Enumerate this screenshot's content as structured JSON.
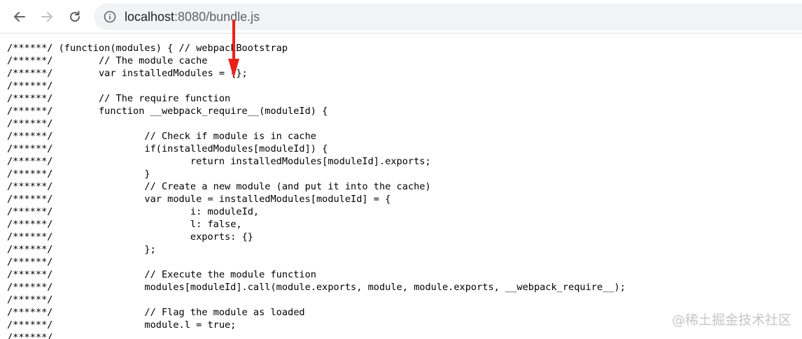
{
  "browser": {
    "url_host": "localhost",
    "url_rest": ":8080/bundle.js",
    "icons": {
      "back": "arrow-back-icon",
      "forward": "arrow-forward-icon",
      "reload": "reload-icon",
      "info": "info-icon"
    }
  },
  "code": {
    "lines": [
      "/******/ (function(modules) { // webpackBootstrap",
      "/******/ \t// The module cache",
      "/******/ \tvar installedModules = {};",
      "/******/",
      "/******/ \t// The require function",
      "/******/ \tfunction __webpack_require__(moduleId) {",
      "/******/",
      "/******/ \t\t// Check if module is in cache",
      "/******/ \t\tif(installedModules[moduleId]) {",
      "/******/ \t\t\treturn installedModules[moduleId].exports;",
      "/******/ \t\t}",
      "/******/ \t\t// Create a new module (and put it into the cache)",
      "/******/ \t\tvar module = installedModules[moduleId] = {",
      "/******/ \t\t\ti: moduleId,",
      "/******/ \t\t\tl: false,",
      "/******/ \t\t\texports: {}",
      "/******/ \t\t};",
      "/******/",
      "/******/ \t\t// Execute the module function",
      "/******/ \t\tmodules[moduleId].call(module.exports, module, module.exports, __webpack_require__);",
      "/******/",
      "/******/ \t\t// Flag the module as loaded",
      "/******/ \t\tmodule.l = true;",
      "/******/"
    ]
  },
  "annotation": {
    "color": "#e8211b"
  },
  "watermark": {
    "text": "@稀土掘金技术社区"
  }
}
